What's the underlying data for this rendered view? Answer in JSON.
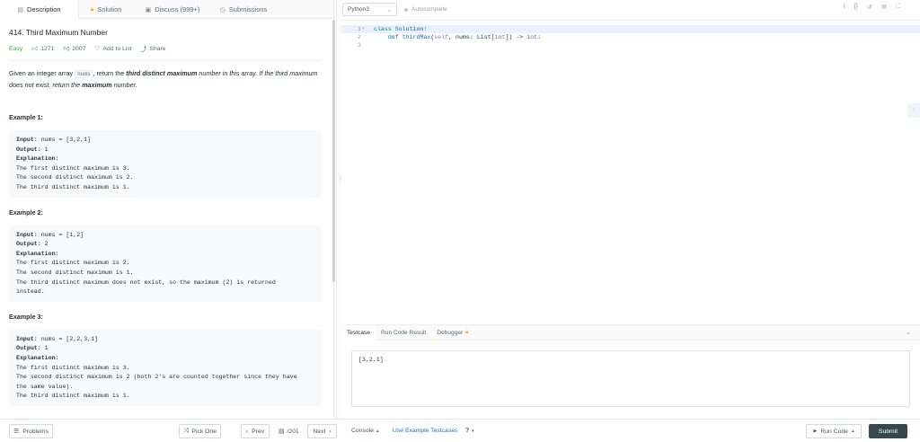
{
  "tabs": [
    {
      "icon": "document-icon",
      "label": "Description"
    },
    {
      "icon": "lock-icon",
      "label": "Solution"
    },
    {
      "icon": "discuss-icon",
      "label": "Discuss (999+)"
    },
    {
      "icon": "clock-icon",
      "label": "Submissions"
    }
  ],
  "problem": {
    "title": "414. Third Maximum Number",
    "difficulty": "Easy",
    "likes": "1271",
    "dislikes": "2007",
    "add_to_list": "Add to List",
    "share": "Share",
    "desc_1": "Given an integer array ",
    "desc_code": "nums",
    "desc_2": ", return the ",
    "desc_strong_1": "third distinct maximum",
    "desc_3": " number in this array. If the third maximum does not exist, return the ",
    "desc_strong_2": "maximum",
    "desc_4": " number."
  },
  "examples": [
    {
      "title": "Example 1:",
      "input_label": "Input:",
      "input": " nums = [3,2,1]",
      "output_label": "Output:",
      "output": " 1",
      "explanation_label": "Explanation:",
      "explanation": "The first distinct maximum is 3.\nThe second distinct maximum is 2.\nThe third distinct maximum is 1."
    },
    {
      "title": "Example 2:",
      "input_label": "Input:",
      "input": " nums = [1,2]",
      "output_label": "Output:",
      "output": " 2",
      "explanation_label": "Explanation:",
      "explanation": "The first distinct maximum is 2.\nThe second distinct maximum is 1.\nThe third distinct maximum does not exist, so the maximum (2) is returned\ninstead."
    },
    {
      "title": "Example 3:",
      "input_label": "Input:",
      "input": " nums = [2,2,3,1]",
      "output_label": "Output:",
      "output": " 1",
      "explanation_label": "Explanation:",
      "explanation": "The first distinct maximum is 3.\nThe second distinct maximum is 2 (both 2's are counted together since they have\nthe same value).\nThe third distinct maximum is 1."
    }
  ],
  "editor": {
    "language": "Python3",
    "autocomplete": "Autocomplete",
    "toolbar_icons": [
      "info-icon",
      "braces-icon",
      "reset-icon",
      "settings-icon",
      "fullscreen-icon"
    ],
    "line_numbers": [
      "1",
      "2",
      "3"
    ],
    "code": {
      "l1_kw": "class",
      "l1_name": " Solution:",
      "l2_indent": "    ",
      "l2_kw": "def",
      "l2_fn": " thirdMax",
      "l2_a": "(",
      "l2_self": "self",
      "l2_b": ", nums: List[",
      "l2_int1": "int",
      "l2_c": "]) -> ",
      "l2_int2": "int",
      "l2_d": ":"
    }
  },
  "console_tabs": [
    "Testcase",
    "Run Code Result",
    "Debugger"
  ],
  "testcase": "[3,2,1]",
  "bottom": {
    "problems": "Problems",
    "pick_one": "Pick One",
    "prev": "Prev",
    "page": "/201",
    "next": "Next",
    "console": "Console",
    "use_example": "Use Example Testcases",
    "run_code": "Run Code",
    "submit": "Submit"
  },
  "colors": {
    "easy": "#43a047",
    "submit_bg": "#37474f",
    "link": "#1976d2"
  }
}
